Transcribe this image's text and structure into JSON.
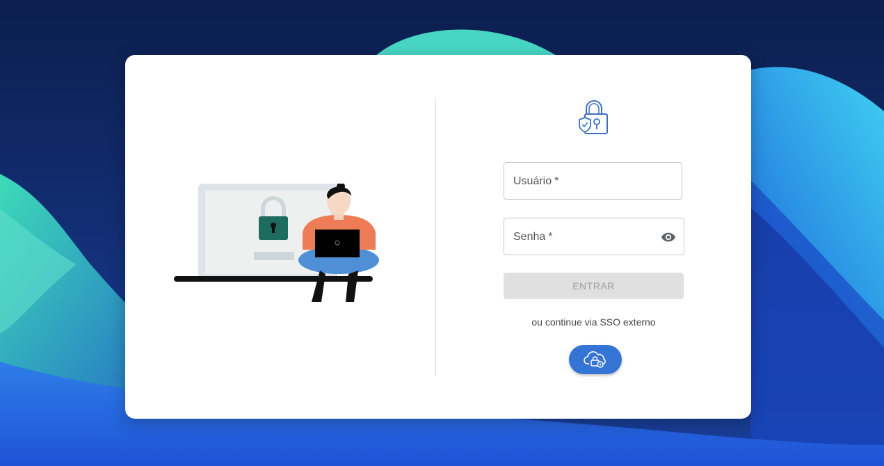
{
  "login": {
    "username_label": "Usuário",
    "password_label": "Senha",
    "required_mark": "*",
    "enter_button_label": "ENTRAR",
    "sso_text": "ou continue via SSO externo"
  },
  "icons": {
    "logo": "shield-lock-icon",
    "password_toggle": "eye-icon",
    "sso": "cloud-lock-icon"
  },
  "colors": {
    "primary": "#3474d4",
    "logo_stroke": "#3a6fc4",
    "disabled_button_bg": "#e0e0e0",
    "disabled_button_text": "#9e9e9e",
    "illustration_lock": "#1e6b60",
    "illustration_shirt": "#ee7d57",
    "illustration_pants": "#4e8fd6"
  }
}
